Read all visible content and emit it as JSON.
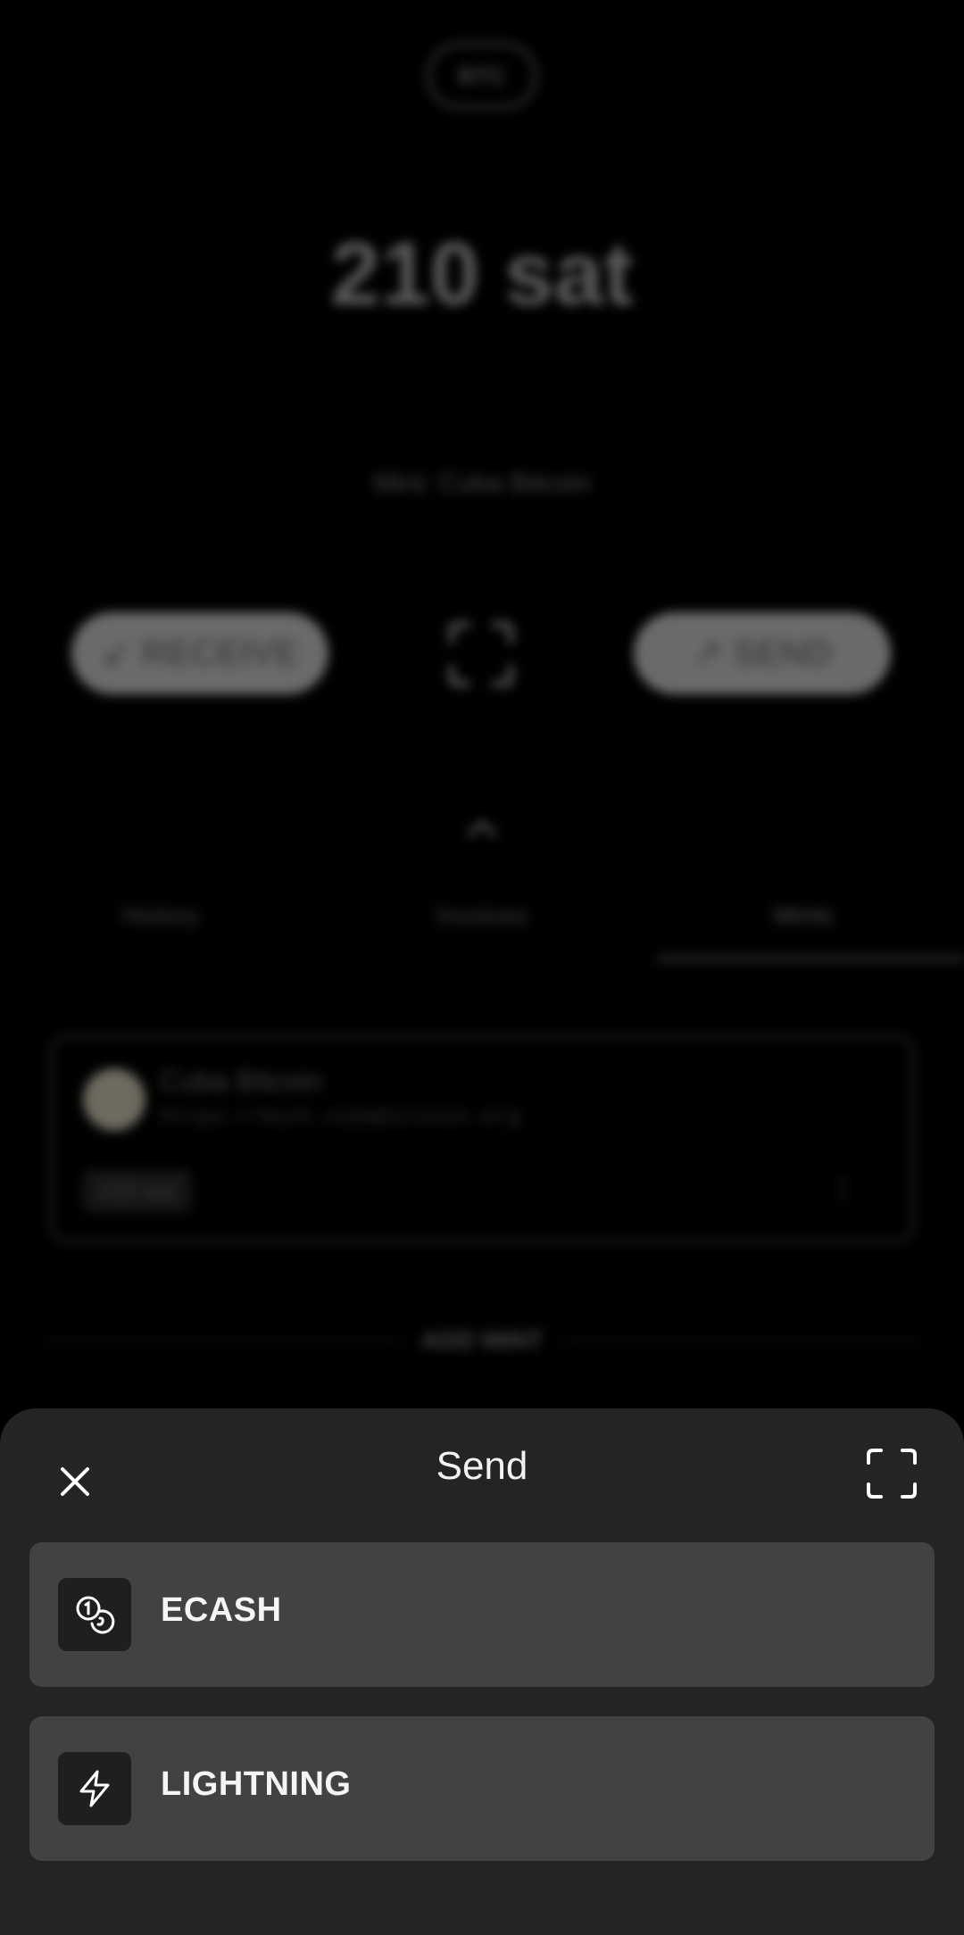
{
  "wallet": {
    "unit": "BTC",
    "balance": "210 sat",
    "mint_label": "Mint: Cuba Bitcoin",
    "receive_label": "↙ RECEIVE",
    "send_label": "↗ SEND"
  },
  "tabs": [
    {
      "label": "History"
    },
    {
      "label": "Invoices"
    },
    {
      "label": "Mints"
    }
  ],
  "active_tab": "Mints",
  "mint_card": {
    "name": "Cuba Bitcoin",
    "url": "https://mint.cubabitcoin.org",
    "balance": "210 sat"
  },
  "add_mint_label": "ADD MINT",
  "sheet": {
    "title": "Send",
    "options": [
      {
        "label": "ECASH",
        "icon": "coins-icon"
      },
      {
        "label": "LIGHTNING",
        "icon": "lightning-icon"
      }
    ]
  }
}
